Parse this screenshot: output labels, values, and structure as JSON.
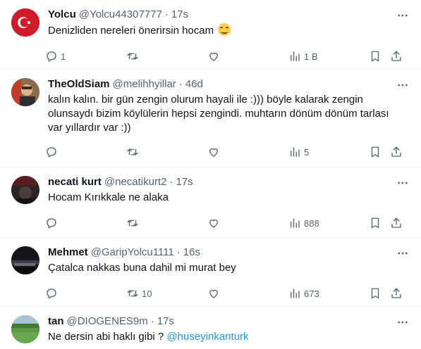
{
  "tweets": [
    {
      "name": "Yolcu",
      "handle": "@Yolcu44307777",
      "time": "17s",
      "text": "Denizliden nereleri önerirsin hocam",
      "emoji": "grinning-face",
      "replies": "1",
      "retweets": "",
      "likes": "",
      "views": "1 B",
      "avatar": "turkish-flag"
    },
    {
      "name": "TheOldSiam",
      "handle": "@melihhyillar",
      "time": "46d",
      "text": "kalın kalın. bir gün zengin olurum hayali ile :))) böyle kalarak zengin olunsaydı bizim köylülerin hepsi zengindi. muhtarın dönüm dönüm tarlası var yıllardır var :))",
      "replies": "",
      "retweets": "",
      "likes": "",
      "views": "5",
      "avatar": "person-photo"
    },
    {
      "name": "necati kurt",
      "handle": "@necatikurt2",
      "time": "17s",
      "text": "Hocam Kırıkkale ne alaka",
      "replies": "",
      "retweets": "",
      "likes": "",
      "views": "888",
      "avatar": "dark-photo"
    },
    {
      "name": "Mehmet",
      "handle": "@GaripYolcu1111",
      "time": "16s",
      "text": "Çatalca nakkas buna dahil mi murat bey",
      "replies": "",
      "retweets": "10",
      "likes": "",
      "views": "673",
      "avatar": "night-photo"
    },
    {
      "name": "tan",
      "handle": "@DIOGENES9m",
      "time": "17s",
      "text": "Ne dersin abi haklı gibi ?",
      "mention": "@huseyinkanturk",
      "replies": "",
      "retweets": "",
      "likes": "",
      "views": "",
      "avatar": "field-photo"
    }
  ],
  "separator": "·"
}
